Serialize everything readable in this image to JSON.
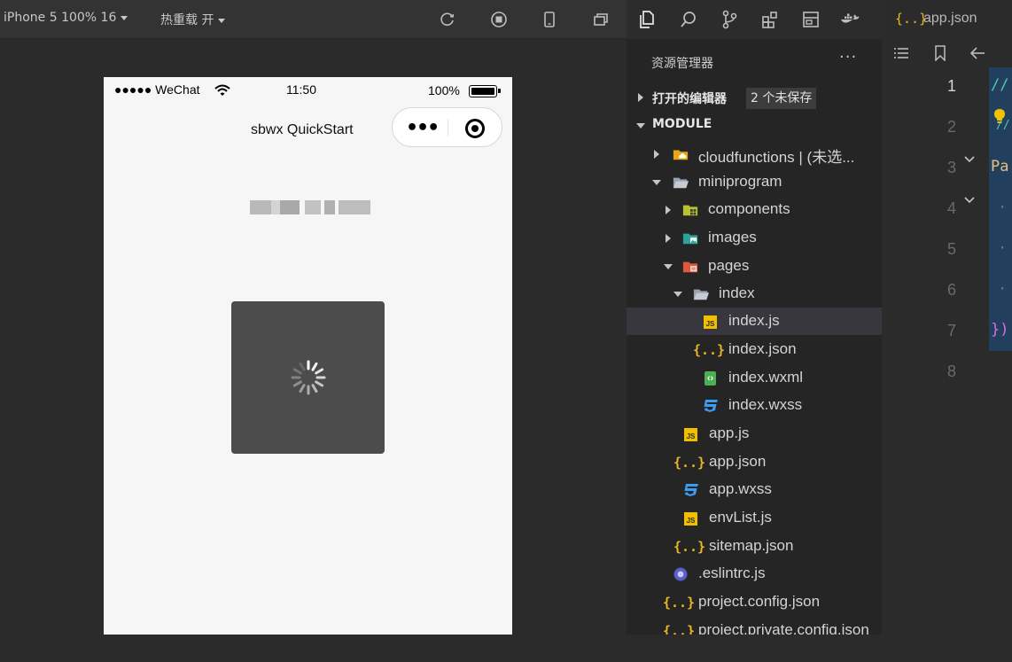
{
  "simulator": {
    "toolbar": {
      "device_label": "iPhone 5 100% 16",
      "hot_reload_label": "热重载 开"
    },
    "phone": {
      "status": {
        "carrier": "●●●●● WeChat",
        "time": "11:50",
        "battery": "100%"
      },
      "nav_title": "sbwx QuickStart"
    }
  },
  "explorer": {
    "title": "资源管理器",
    "more": "···",
    "open_editors": {
      "label": "打开的编辑器",
      "badge": "2 个未保存"
    },
    "module": {
      "label": "MODULE"
    },
    "tree": [
      {
        "label": "cloudfunctions | (未选...",
        "icon": "cloud-folder-icon"
      },
      {
        "label": "miniprogram",
        "icon": "folder-open-icon"
      },
      {
        "label": "components",
        "icon": "components-folder-icon"
      },
      {
        "label": "images",
        "icon": "images-folder-icon"
      },
      {
        "label": "pages",
        "icon": "pages-folder-icon"
      },
      {
        "label": "index",
        "icon": "folder-open-icon"
      },
      {
        "label": "index.js",
        "icon": "js-file-icon"
      },
      {
        "label": "index.json",
        "icon": "json-file-icon"
      },
      {
        "label": "index.wxml",
        "icon": "wxml-file-icon"
      },
      {
        "label": "index.wxss",
        "icon": "wxss-file-icon"
      },
      {
        "label": "app.js",
        "icon": "js-file-icon"
      },
      {
        "label": "app.json",
        "icon": "json-file-icon"
      },
      {
        "label": "app.wxss",
        "icon": "wxss-file-icon"
      },
      {
        "label": "envList.js",
        "icon": "js-file-icon"
      },
      {
        "label": "sitemap.json",
        "icon": "json-file-icon"
      },
      {
        "label": ".eslintrc.js",
        "icon": "eslint-file-icon"
      },
      {
        "label": "project.config.json",
        "icon": "json-file-icon"
      },
      {
        "label": "project.private.config.json",
        "icon": "json-file-icon"
      }
    ]
  },
  "editor": {
    "tab": {
      "icon_text": "{..}",
      "label": "app.json"
    },
    "line_numbers": [
      "1",
      "2",
      "3",
      "4",
      "5",
      "6",
      "7",
      "8"
    ],
    "code_fragments": [
      "//",
      "//",
      "Pa",
      "·",
      "·",
      "·",
      "})"
    ]
  },
  "colors": {
    "background": "#2b2b2b",
    "explorer_bg": "#252526",
    "selected_row": "#37373d",
    "js_badge": "#f0c000",
    "json_badge": "#e9b820",
    "wxss_badge": "#3d9cf2",
    "phone_bg": "#f6f6f6",
    "toast_bg": "#4c4c4c"
  }
}
